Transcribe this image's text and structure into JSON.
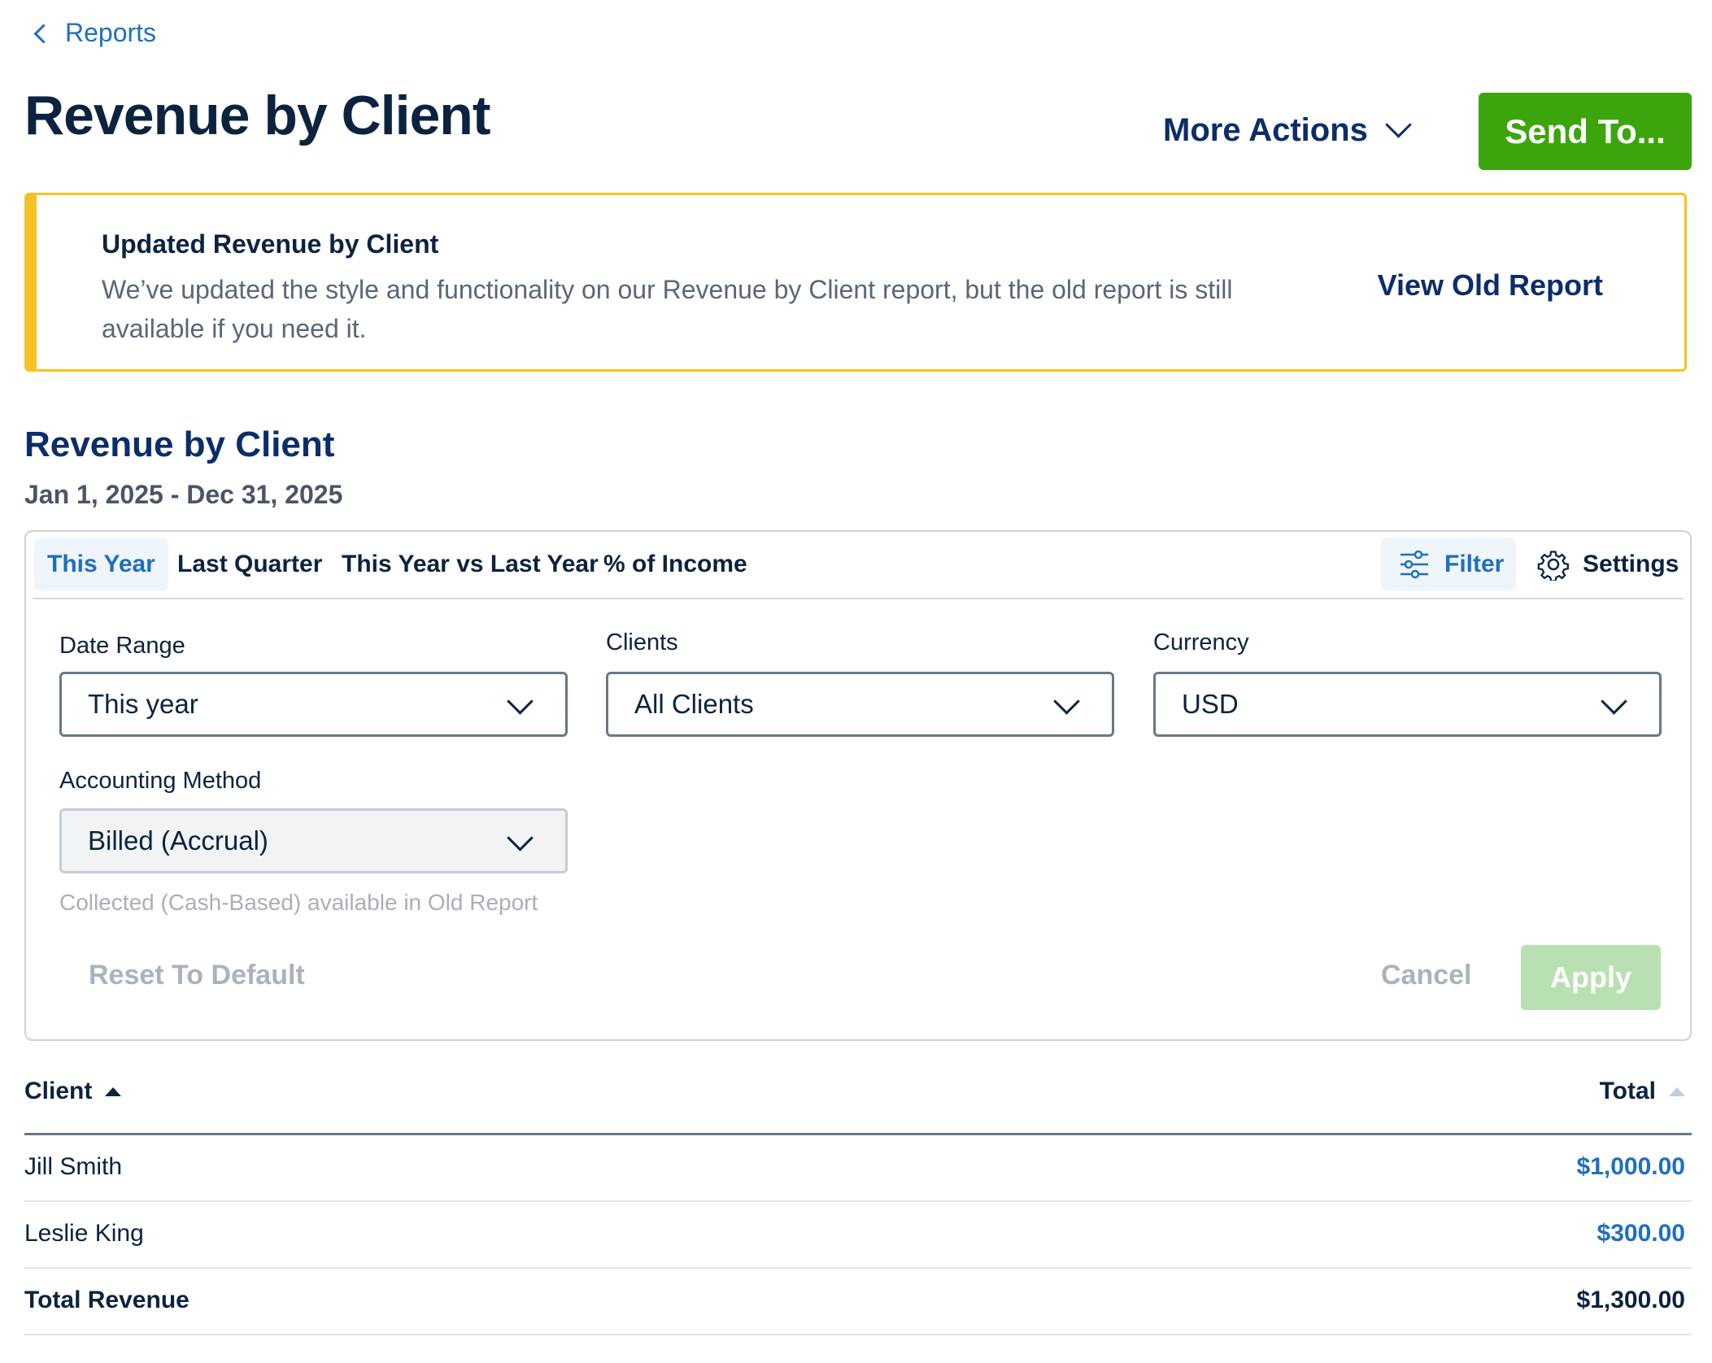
{
  "breadcrumb": {
    "label": "Reports"
  },
  "page_title": "Revenue by Client",
  "header": {
    "more_actions_label": "More Actions",
    "send_label": "Send To..."
  },
  "notice": {
    "title": "Updated Revenue by Client",
    "body": "We’ve updated the style and functionality on our Revenue by Client report, but the old report is still available if you need it.",
    "link_label": "View Old Report",
    "accent_color": "#f5c124"
  },
  "report": {
    "title": "Revenue by Client",
    "date_range": "Jan 1, 2025 - Dec 31, 2025"
  },
  "tabs": [
    {
      "label": "This Year",
      "active": true
    },
    {
      "label": "Last Quarter",
      "active": false
    },
    {
      "label": "This Year vs Last Year",
      "active": false
    },
    {
      "label": "% of Income",
      "active": false
    }
  ],
  "toolbar": {
    "filter_label": "Filter",
    "settings_label": "Settings"
  },
  "filters": {
    "date_range": {
      "label": "Date Range",
      "value": "This year"
    },
    "clients": {
      "label": "Clients",
      "value": "All Clients"
    },
    "currency": {
      "label": "Currency",
      "value": "USD"
    },
    "accounting_method": {
      "label": "Accounting Method",
      "value": "Billed (Accrual)",
      "hint": "Collected (Cash-Based) available in Old Report"
    },
    "reset_label": "Reset To Default",
    "cancel_label": "Cancel",
    "apply_label": "Apply"
  },
  "table": {
    "columns": {
      "client": "Client",
      "total": "Total"
    },
    "rows": [
      {
        "client": "Jill Smith",
        "total": "$1,000.00"
      },
      {
        "client": "Leslie King",
        "total": "$300.00"
      }
    ],
    "summary": {
      "label": "Total Revenue",
      "total": "$1,300.00"
    }
  },
  "colors": {
    "brand_green": "#3da50c",
    "link_blue": "#1f6fbf",
    "navy": "#0c2d6b"
  }
}
